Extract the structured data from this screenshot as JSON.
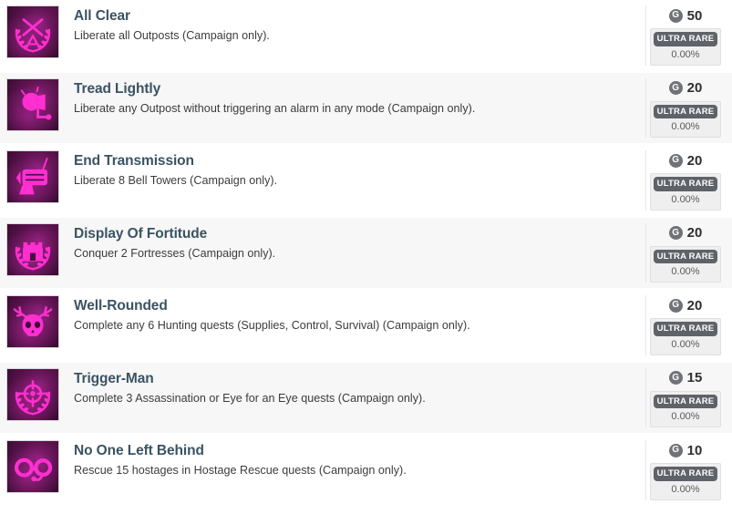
{
  "page": {
    "kind": "achievement-list",
    "accent_icon_color": "#ff2fd0",
    "title_color": "#3a5362",
    "rarity_pill_color": "#5f6369",
    "score_badge_letter": "G"
  },
  "achievements": [
    {
      "title": "All Clear",
      "description": "Liberate all Outposts (Campaign only).",
      "score": "50",
      "score_badge": "G",
      "rarity": "ULTRA RARE",
      "percent": "0.00%",
      "icon": "crossed-rifles-laurel-icon"
    },
    {
      "title": "Tread Lightly",
      "description": "Liberate any Outpost without triggering an alarm in any mode (Campaign only).",
      "score": "20",
      "score_badge": "G",
      "rarity": "ULTRA RARE",
      "percent": "0.00%",
      "icon": "alarm-siren-icon"
    },
    {
      "title": "End Transmission",
      "description": "Liberate 8 Bell Towers (Campaign only).",
      "score": "20",
      "score_badge": "G",
      "rarity": "ULTRA RARE",
      "percent": "0.00%",
      "icon": "radio-transmitter-icon"
    },
    {
      "title": "Display Of Fortitude",
      "description": "Conquer 2 Fortresses (Campaign only).",
      "score": "20",
      "score_badge": "G",
      "rarity": "ULTRA RARE",
      "percent": "0.00%",
      "icon": "fortress-laurel-icon"
    },
    {
      "title": "Well-Rounded",
      "description": "Complete any 6 Hunting quests (Supplies, Control, Survival) (Campaign only).",
      "score": "20",
      "score_badge": "G",
      "rarity": "ULTRA RARE",
      "percent": "0.00%",
      "icon": "antlered-skull-icon"
    },
    {
      "title": "Trigger-Man",
      "description": "Complete 3 Assassination or Eye for an Eye quests (Campaign only).",
      "score": "15",
      "score_badge": "G",
      "rarity": "ULTRA RARE",
      "percent": "0.00%",
      "icon": "crosshair-laurel-icon"
    },
    {
      "title": "No One Left Behind",
      "description": "Rescue 15 hostages in Hostage Rescue quests (Campaign only).",
      "score": "10",
      "score_badge": "G",
      "rarity": "ULTRA RARE",
      "percent": "0.00%",
      "icon": "handcuffs-icon"
    }
  ]
}
